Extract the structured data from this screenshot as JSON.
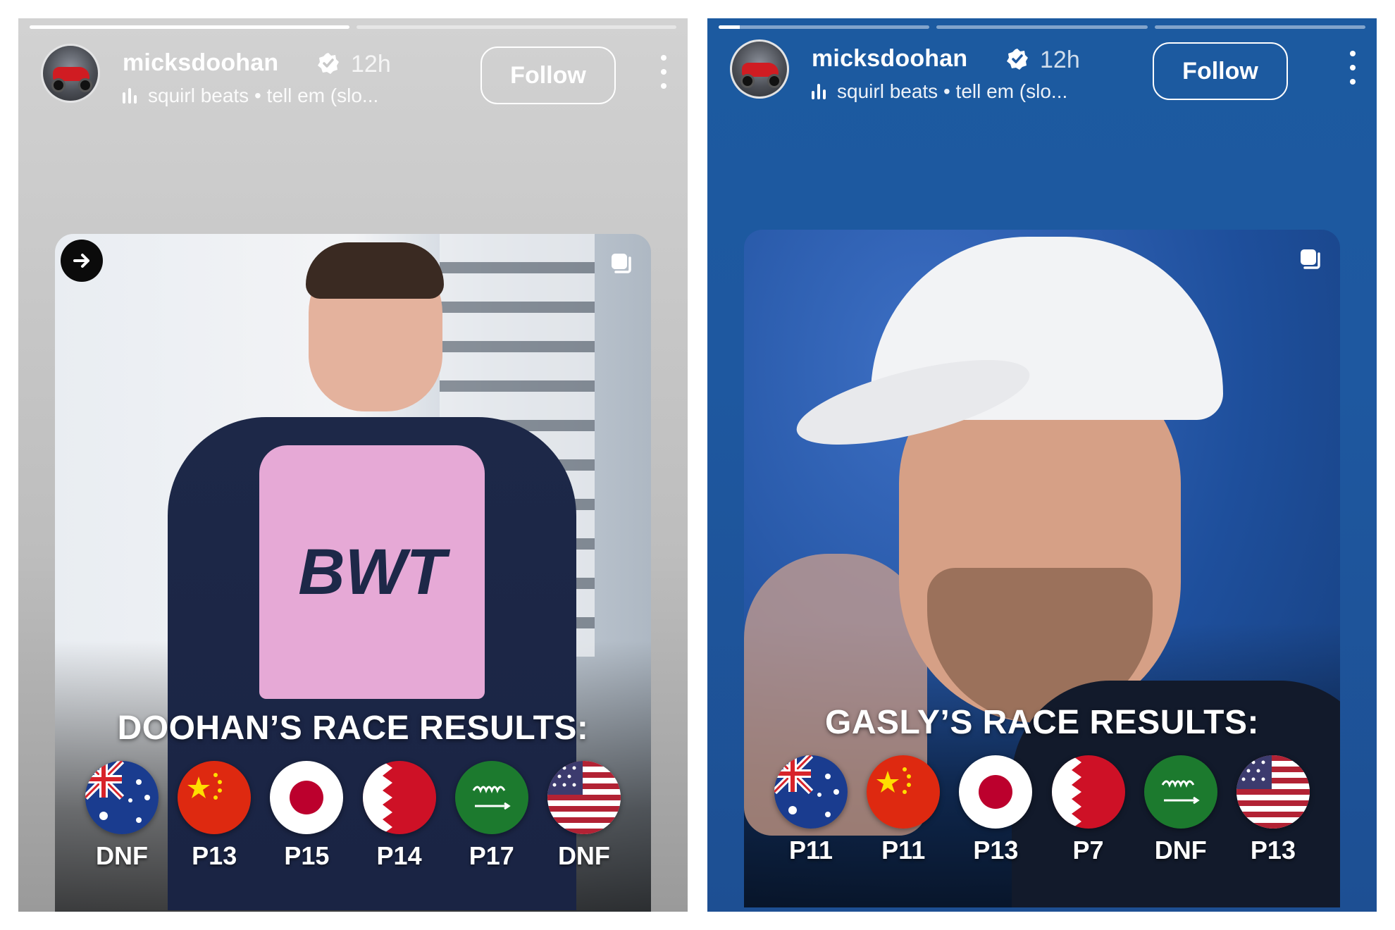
{
  "stories": [
    {
      "username": "micksdoohan",
      "time_ago": "12h",
      "music": "squirl beats • tell em (slo...",
      "follow_label": "Follow",
      "progress": [
        1.0,
        0.0
      ],
      "card": {
        "title": "DOOHAN’S RACE RESULTS:",
        "results": [
          {
            "flag": "australia-flag-icon",
            "result": "DNF"
          },
          {
            "flag": "china-flag-icon",
            "result": "P13"
          },
          {
            "flag": "japan-flag-icon",
            "result": "P15"
          },
          {
            "flag": "bahrain-flag-icon",
            "result": "P14"
          },
          {
            "flag": "saudi-arabia-flag-icon",
            "result": "P17"
          },
          {
            "flag": "usa-flag-icon",
            "result": "DNF"
          }
        ]
      }
    },
    {
      "username": "micksdoohan",
      "time_ago": "12h",
      "music": "squirl beats • tell em (slo...",
      "follow_label": "Follow",
      "progress": [
        0.1,
        0.0,
        0.0
      ],
      "card": {
        "title": "GASLY’S RACE RESULTS:",
        "results": [
          {
            "flag": "australia-flag-icon",
            "result": "P11"
          },
          {
            "flag": "china-flag-icon",
            "result": "P11"
          },
          {
            "flag": "japan-flag-icon",
            "result": "P13"
          },
          {
            "flag": "bahrain-flag-icon",
            "result": "P7"
          },
          {
            "flag": "saudi-arabia-flag-icon",
            "result": "DNF"
          },
          {
            "flag": "usa-flag-icon",
            "result": "P13"
          }
        ]
      }
    }
  ],
  "colors": {
    "left_background": "#c8c8c8",
    "right_background": "#1e58a0",
    "text": "#ffffff"
  }
}
